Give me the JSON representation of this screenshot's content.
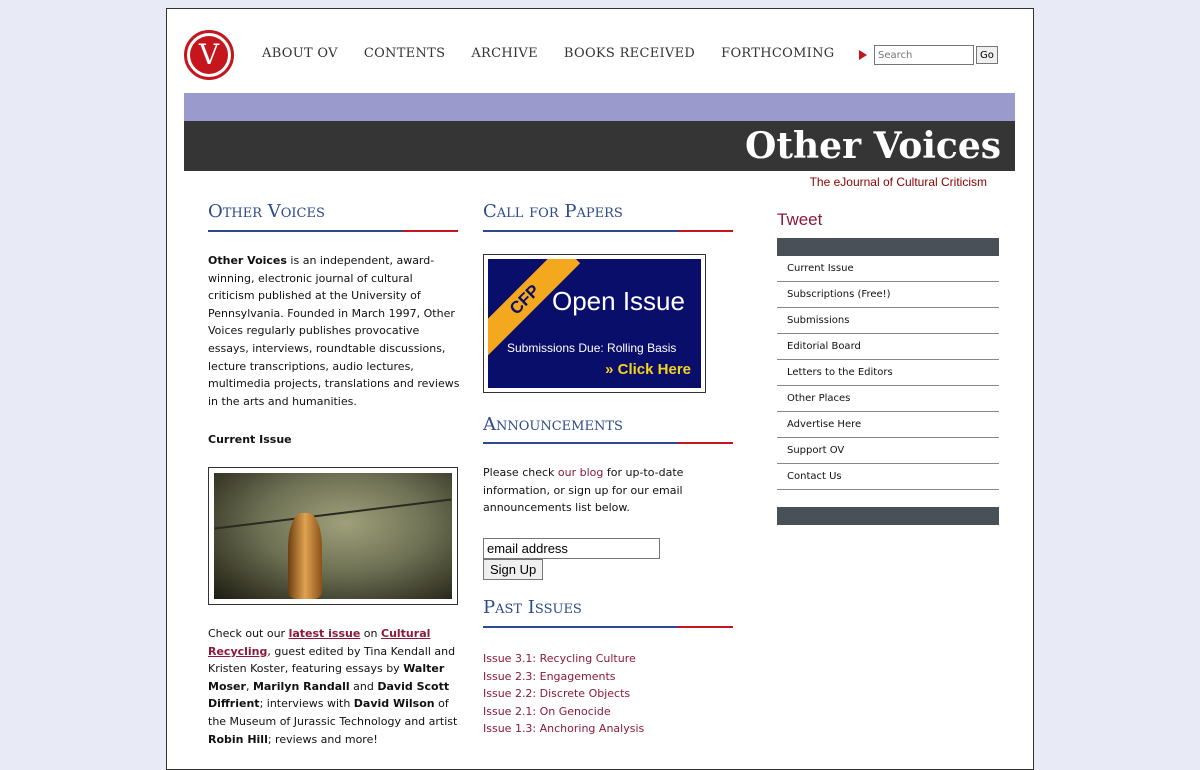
{
  "header": {
    "logo_letter": "V",
    "nav": [
      "ABOUT OV",
      "CONTENTS",
      "ARCHIVE",
      "BOOKS RECEIVED",
      "FORTHCOMING"
    ],
    "search_placeholder": "Search",
    "search_button": "Go"
  },
  "banner": {
    "title": "Other Voices",
    "tagline": "The eJournal of Cultural Criticism"
  },
  "left": {
    "heading": "Other Voices",
    "intro_bold": "Other Voices",
    "intro_rest": " is an independent, award-winning, electronic journal of cultural criticism published at the University of Pennsylvania. Founded in March 1997, Other Voices regularly publishes provocative essays, interviews, roundtable discussions, lecture transcriptions, audio lectures, multimedia projects, translations and reviews in the arts and humanities.",
    "current_issue_label": "Current Issue",
    "promo": {
      "t1": "Check out our ",
      "link1": "latest issue",
      "t2": " on ",
      "link2": "Cultural Recycling",
      "t3": ", guest edited by Tina Kendall and Kristen Koster, featuring essays by ",
      "n1": "Walter Moser",
      "t4": ", ",
      "n2": "Marilyn Randall",
      "t5": " and ",
      "n3": "David Scott Diffrient",
      "t6": "; interviews with ",
      "n4": "David Wilson",
      "t7": " of the Museum of Jurassic Technology and artist ",
      "n5": "Robin Hill",
      "t8": "; reviews and more!"
    }
  },
  "middle": {
    "cfp_heading": "Call for Papers",
    "cfp_banner": {
      "ribbon": "CFP",
      "title": "Open Issue",
      "subtitle": "Submissions Due: Rolling Basis",
      "click": "» Click Here"
    },
    "announcements_heading": "Announcements",
    "ann_t1": "Please check ",
    "ann_link": "our blog",
    "ann_t2": " for up-to-date information, or sign up for our email announcements list below.",
    "email_value": "email address",
    "signup_label": "Sign Up",
    "past_heading": "Past Issues",
    "past_issues": [
      "Issue 3.1: Recycling Culture",
      "Issue 2.3: Engagements",
      "Issue 2.2: Discrete Objects",
      "Issue 2.1: On Genocide",
      "Issue 1.3: Anchoring Analysis"
    ]
  },
  "right": {
    "tweet": "Tweet",
    "menu": [
      "Current Issue",
      "Subscriptions (Free!)",
      "Submissions",
      "Editorial Board",
      "Letters to the Editors",
      "Other Places",
      "Advertise Here",
      "Support OV",
      "Contact Us"
    ]
  },
  "colors": {
    "accent_red": "#c4161c",
    "heading_blue": "#2c4a8c",
    "link_maroon": "#8b1a3a",
    "band_purple": "#9a9bcc",
    "band_dark": "#353535"
  }
}
